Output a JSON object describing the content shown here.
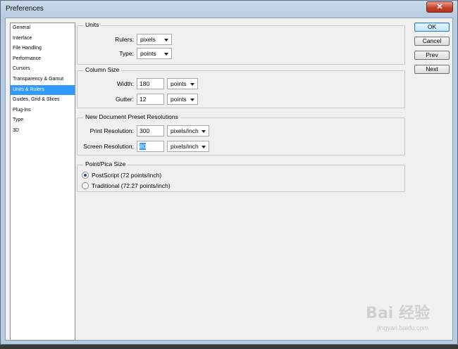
{
  "window": {
    "title": "Preferences",
    "close_glyph": "✕"
  },
  "sidebar": {
    "items": [
      {
        "label": "General"
      },
      {
        "label": "Interface"
      },
      {
        "label": "File Handling"
      },
      {
        "label": "Performance"
      },
      {
        "label": "Cursors"
      },
      {
        "label": "Transparency & Gamut"
      },
      {
        "label": "Units & Rulers",
        "selected": true
      },
      {
        "label": "Guides, Grid & Slices"
      },
      {
        "label": "Plug-Ins"
      },
      {
        "label": "Type"
      },
      {
        "label": "3D"
      }
    ]
  },
  "units": {
    "title": "Units",
    "rulers_label": "Rulers:",
    "rulers_value": "pixels",
    "type_label": "Type:",
    "type_value": "points"
  },
  "column_size": {
    "title": "Column Size",
    "width_label": "Width:",
    "width_value": "180",
    "width_unit": "points",
    "gutter_label": "Gutter:",
    "gutter_value": "12",
    "gutter_unit": "points"
  },
  "preset_resolutions": {
    "title": "New Document Preset Resolutions",
    "print_label": "Print Resolution:",
    "print_value": "300",
    "print_unit": "pixels/inch",
    "screen_label": "Screen Resolution:",
    "screen_value": "80",
    "screen_unit": "pixels/inch"
  },
  "point_pica": {
    "title": "Point/Pica Size",
    "postscript_label": "PostScript (72 points/inch)",
    "traditional_label": "Traditional (72.27 points/inch)",
    "selected": "postscript"
  },
  "buttons": {
    "ok": "OK",
    "cancel": "Cancel",
    "prev": "Prev",
    "next": "Next"
  },
  "watermark": {
    "main": "Bai 经验",
    "sub": "jingyan.baidu.com"
  },
  "colors": {
    "selection": "#3399ff",
    "panel": "#f0f0f0"
  }
}
